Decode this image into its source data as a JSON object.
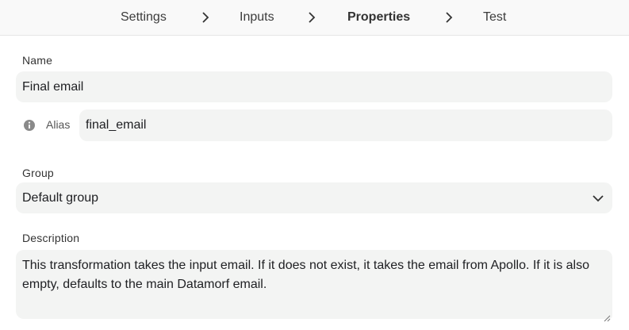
{
  "breadcrumb": {
    "items": [
      {
        "label": "Settings"
      },
      {
        "label": "Inputs"
      },
      {
        "label": "Properties",
        "active": true
      },
      {
        "label": "Test"
      }
    ]
  },
  "form": {
    "name": {
      "label": "Name",
      "value": "Final email"
    },
    "alias": {
      "label": "Alias",
      "value": "final_email",
      "icon": "info-icon"
    },
    "group": {
      "label": "Group",
      "value": "Default group",
      "icon": "chevron-down-icon"
    },
    "description": {
      "label": "Description",
      "value": "This transformation takes the input email. If it does not exist, it takes the email from Apollo. If it is also empty, defaults to the main Datamorf email."
    }
  },
  "colors": {
    "field_bg": "#f3f4f3",
    "breadcrumb_bg": "#f9f9f9",
    "text": "#202124"
  }
}
